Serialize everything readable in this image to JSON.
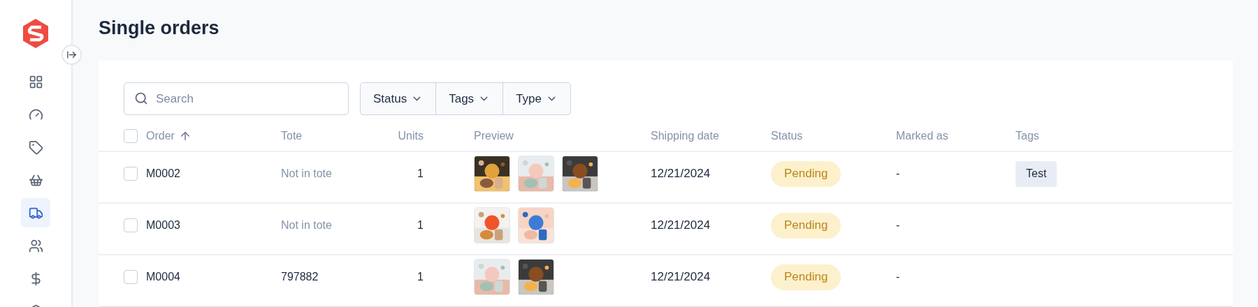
{
  "sidebar": {
    "items": [
      {
        "selected": false
      },
      {
        "selected": false
      },
      {
        "selected": false
      },
      {
        "selected": false
      },
      {
        "selected": true
      },
      {
        "selected": false
      },
      {
        "selected": false
      },
      {
        "selected": false
      }
    ]
  },
  "page": {
    "title": "Single orders"
  },
  "search": {
    "placeholder": "Search"
  },
  "filters": [
    {
      "label": "Status"
    },
    {
      "label": "Tags"
    },
    {
      "label": "Type"
    }
  ],
  "table": {
    "select_all": {
      "checked": false
    },
    "columns": [
      {
        "label": "Order",
        "sorted": true
      },
      {
        "label": "Tote",
        "sorted": false
      },
      {
        "label": "Units",
        "sorted": false
      },
      {
        "label": "Preview",
        "sorted": false
      },
      {
        "label": "Shipping date",
        "sorted": false
      },
      {
        "label": "Status",
        "sorted": false
      },
      {
        "label": "Marked as",
        "sorted": false
      },
      {
        "label": "Tags",
        "sorted": false
      }
    ],
    "rows": [
      {
        "checked": false,
        "order": "M0002",
        "tote": {
          "text": "Not in tote",
          "muted": true
        },
        "units": "1",
        "preview": [
          {
            "kind": "picture"
          },
          {
            "kind": "picture"
          },
          {
            "kind": "picture"
          }
        ],
        "shipping_date": "12/21/2024",
        "status": {
          "label": "Pending",
          "kind": "pending"
        },
        "marked_as": "-",
        "tags": [
          "Test"
        ]
      },
      {
        "checked": false,
        "order": "M0003",
        "tote": {
          "text": "Not in tote",
          "muted": true
        },
        "units": "1",
        "preview": [
          {
            "kind": "picture"
          },
          {
            "kind": "picture"
          }
        ],
        "shipping_date": "12/21/2024",
        "status": {
          "label": "Pending",
          "kind": "pending"
        },
        "marked_as": "-"
      },
      {
        "checked": false,
        "order": "M0004",
        "tote": {
          "text": "797882",
          "muted": false
        },
        "units": "1",
        "preview": [
          {
            "kind": "picture"
          },
          {
            "kind": "picture"
          }
        ],
        "shipping_date": "12/21/2024",
        "status": {
          "label": "Pending",
          "kind": "pending"
        },
        "marked_as": "-"
      }
    ]
  }
}
